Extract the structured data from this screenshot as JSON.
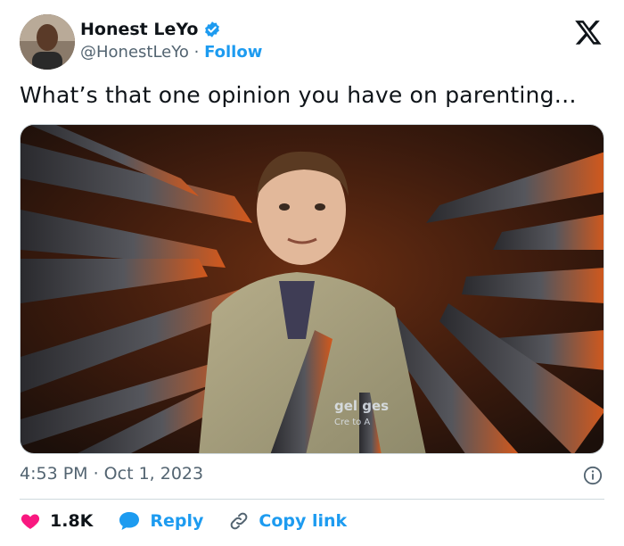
{
  "author": {
    "display_name": "Honest LeYo",
    "handle": "@HonestLeYo",
    "separator": "·",
    "follow_label": "Follow"
  },
  "tweet": {
    "text": "What’s that one opinion you have on parenting…",
    "timestamp": "4:53 PM · Oct 1, 2023"
  },
  "media": {
    "watermark_line1": "gel    ges",
    "watermark_line2": "Cre    to A"
  },
  "actions": {
    "like_count": "1.8K",
    "reply_label": "Reply",
    "copy_label": "Copy link"
  },
  "colors": {
    "accent": "#1d9bf0",
    "like": "#f91880",
    "muted": "#536471"
  },
  "icons": [
    "verified-badge-icon",
    "x-logo-icon",
    "info-icon",
    "heart-icon",
    "reply-bubble-icon",
    "link-icon"
  ]
}
